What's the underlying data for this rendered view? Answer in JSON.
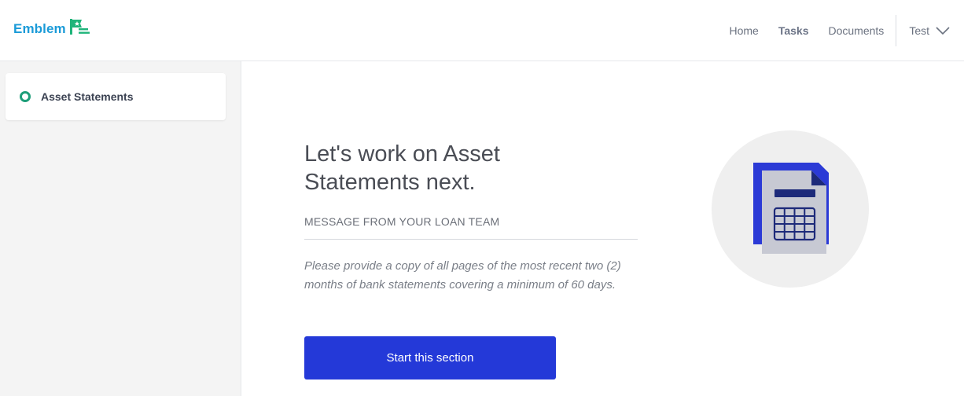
{
  "brand": {
    "name": "Emblem"
  },
  "nav": {
    "links": [
      {
        "label": "Home",
        "active": false
      },
      {
        "label": "Tasks",
        "active": true
      },
      {
        "label": "Documents",
        "active": false
      }
    ],
    "user": "Test",
    "user_icon": "chevron-down-icon"
  },
  "sidebar": {
    "items": [
      {
        "label": "Asset Statements",
        "status_icon": "ring-icon",
        "status_color": "#1e9e79"
      }
    ]
  },
  "main": {
    "title": "Let's work on Asset Statements next.",
    "message_label": "MESSAGE FROM YOUR LOAN TEAM",
    "message_text": "Please provide a copy of all pages of the most recent two (2) months of bank statements covering a minimum of 60 days.",
    "start_button": "Start this section",
    "illustration_icon": "spreadsheet-document-icon"
  },
  "colors": {
    "brand_text": "#1b9bd8",
    "brand_mark": "#1fb47a",
    "primary_button": "#2439d8",
    "sidebar_bg": "#f4f4f4"
  }
}
